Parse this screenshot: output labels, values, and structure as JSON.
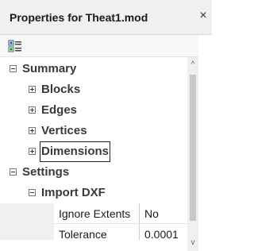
{
  "window": {
    "title": "Properties for Theat1.mod",
    "close_glyph": "×"
  },
  "toolbar": {
    "categorized_icon": "categorized-view-icon"
  },
  "tree": {
    "summary": {
      "label": "Summary",
      "children": [
        "Blocks",
        "Edges",
        "Vertices",
        "Dimensions"
      ]
    },
    "settings": {
      "label": "Settings",
      "import_dxf": {
        "label": "Import DXF",
        "properties": [
          {
            "name": "Ignore Extents",
            "value": "No"
          },
          {
            "name": "Tolerance",
            "value": "0.0001"
          }
        ]
      }
    }
  },
  "scrollbar": {
    "up_glyph": "^",
    "down_glyph": "v"
  }
}
